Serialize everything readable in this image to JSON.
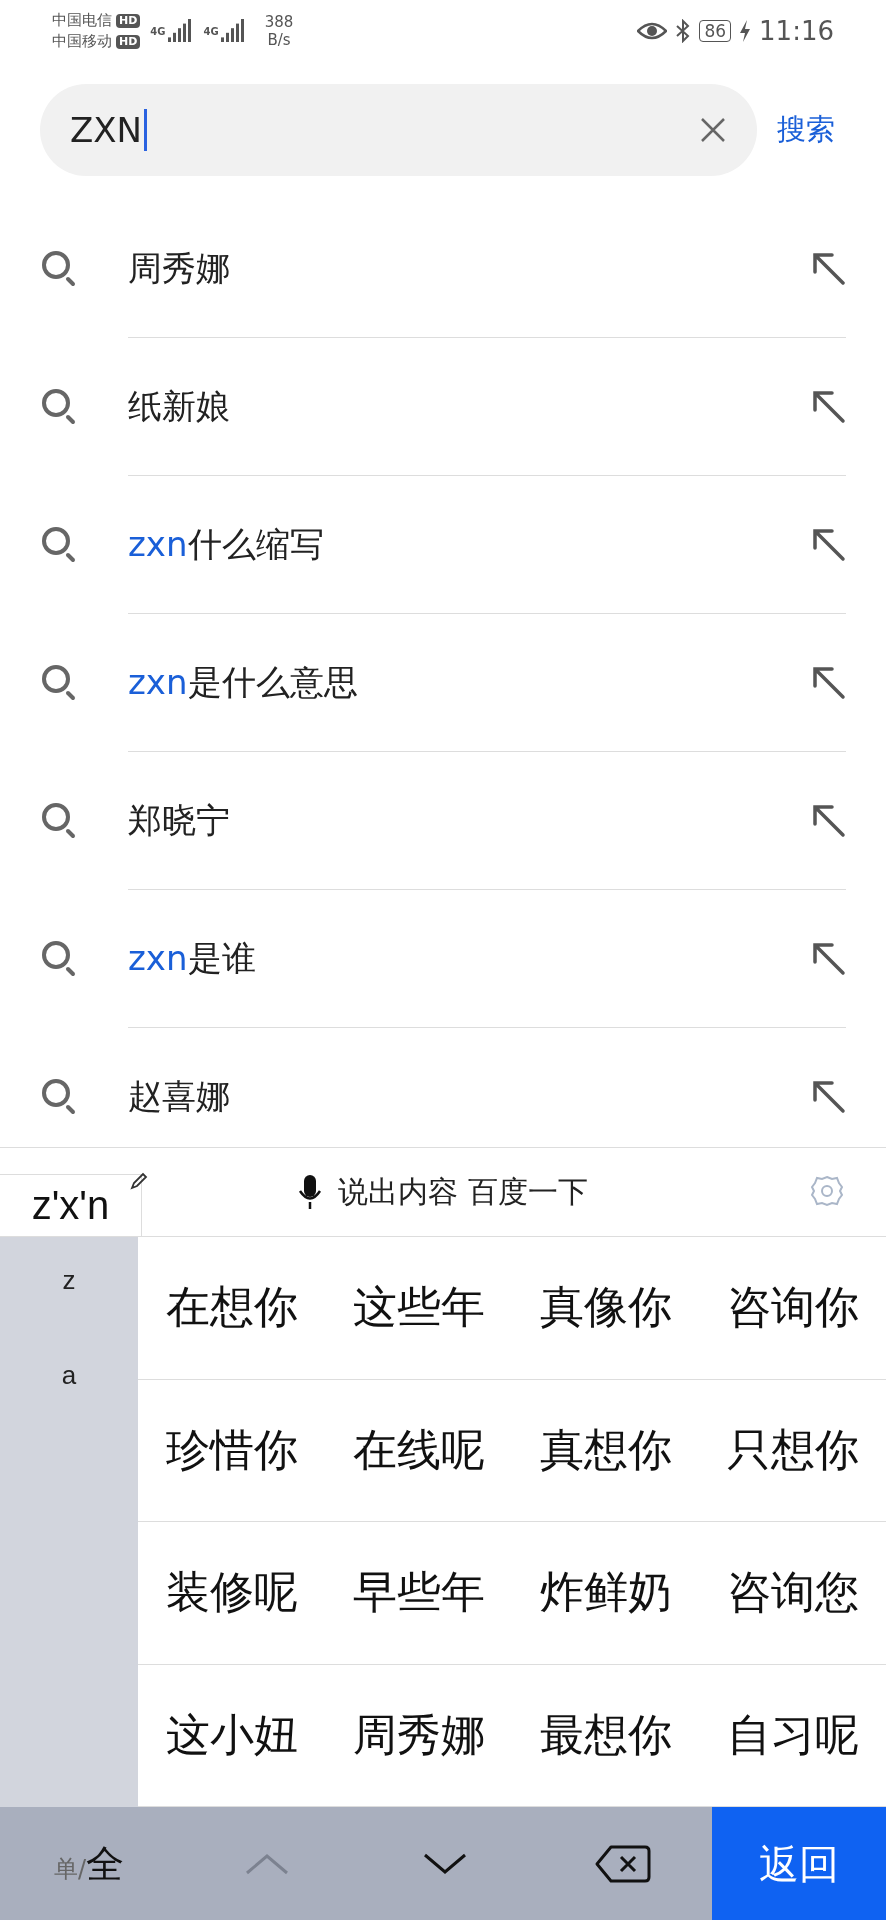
{
  "status_bar": {
    "carriers": [
      {
        "name": "中国电信",
        "badge": "HD"
      },
      {
        "name": "中国移动",
        "badge": "HD"
      }
    ],
    "networks": [
      "4G",
      "4G"
    ],
    "speed": "388",
    "speed_unit": "B/s",
    "battery": "86",
    "time": "11:16"
  },
  "search": {
    "value": "ZXN",
    "button": "搜索"
  },
  "suggestions": [
    {
      "text": "周秀娜"
    },
    {
      "text": "纸新娘"
    },
    {
      "match": "zxn",
      "text": "什么缩写"
    },
    {
      "match": "zxn",
      "text": "是什么意思"
    },
    {
      "text": "郑晓宁"
    },
    {
      "match": "zxn",
      "text": "是谁"
    },
    {
      "text": "赵喜娜"
    }
  ],
  "keyboard": {
    "composing": "z'x'n",
    "voice_hint": "说出内容 百度一下",
    "pinyin_options": [
      "z",
      "a"
    ],
    "candidates": [
      "在想你",
      "这些年",
      "真像你",
      "咨询你",
      "珍惜你",
      "在线呢",
      "真想你",
      "只想你",
      "装修呢",
      "早些年",
      "炸鲜奶",
      "咨询您",
      "这小妞",
      "周秀娜",
      "最想你",
      "自习呢"
    ],
    "width_toggle_separator": "/",
    "width_toggle": [
      {
        "label": "单",
        "selected": false
      },
      {
        "label": "全",
        "selected": true
      }
    ],
    "enter_key": "返回"
  }
}
